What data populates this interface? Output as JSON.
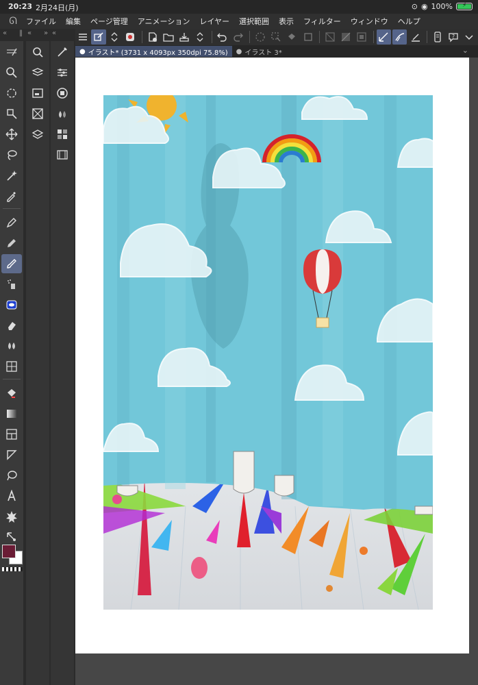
{
  "status": {
    "time": "20:23",
    "date": "2月24日(月)",
    "battery_text": "100%",
    "battery_level": 1.0
  },
  "menu": {
    "items": [
      "ファイル",
      "編集",
      "ページ管理",
      "アニメーション",
      "レイヤー",
      "選択範囲",
      "表示",
      "フィルター",
      "ウィンドウ",
      "ヘルプ"
    ]
  },
  "tabs": [
    {
      "label": "イラスト* (3731 x 4093px 350dpi 75.8%)",
      "active": true
    },
    {
      "label": "イラスト 3*",
      "active": false
    }
  ],
  "colors": {
    "main_color": "#6a1c35",
    "sub_color": "#ffffff",
    "accent": "#55648a"
  },
  "tools": [
    "zoom-icon",
    "rotate-icon",
    "object-icon",
    "move-icon",
    "lasso-icon",
    "magic-wand-icon",
    "eyedropper-icon",
    "pen-icon",
    "pencil-icon",
    "brush-icon",
    "airbrush-icon",
    "decoration-icon",
    "eraser-icon",
    "blend-icon",
    "perspective-icon",
    "fill-icon",
    "gradient-icon",
    "frame-icon",
    "ruler-icon",
    "lasso-fill-icon",
    "text-icon",
    "balloon-icon",
    "correction-icon"
  ]
}
